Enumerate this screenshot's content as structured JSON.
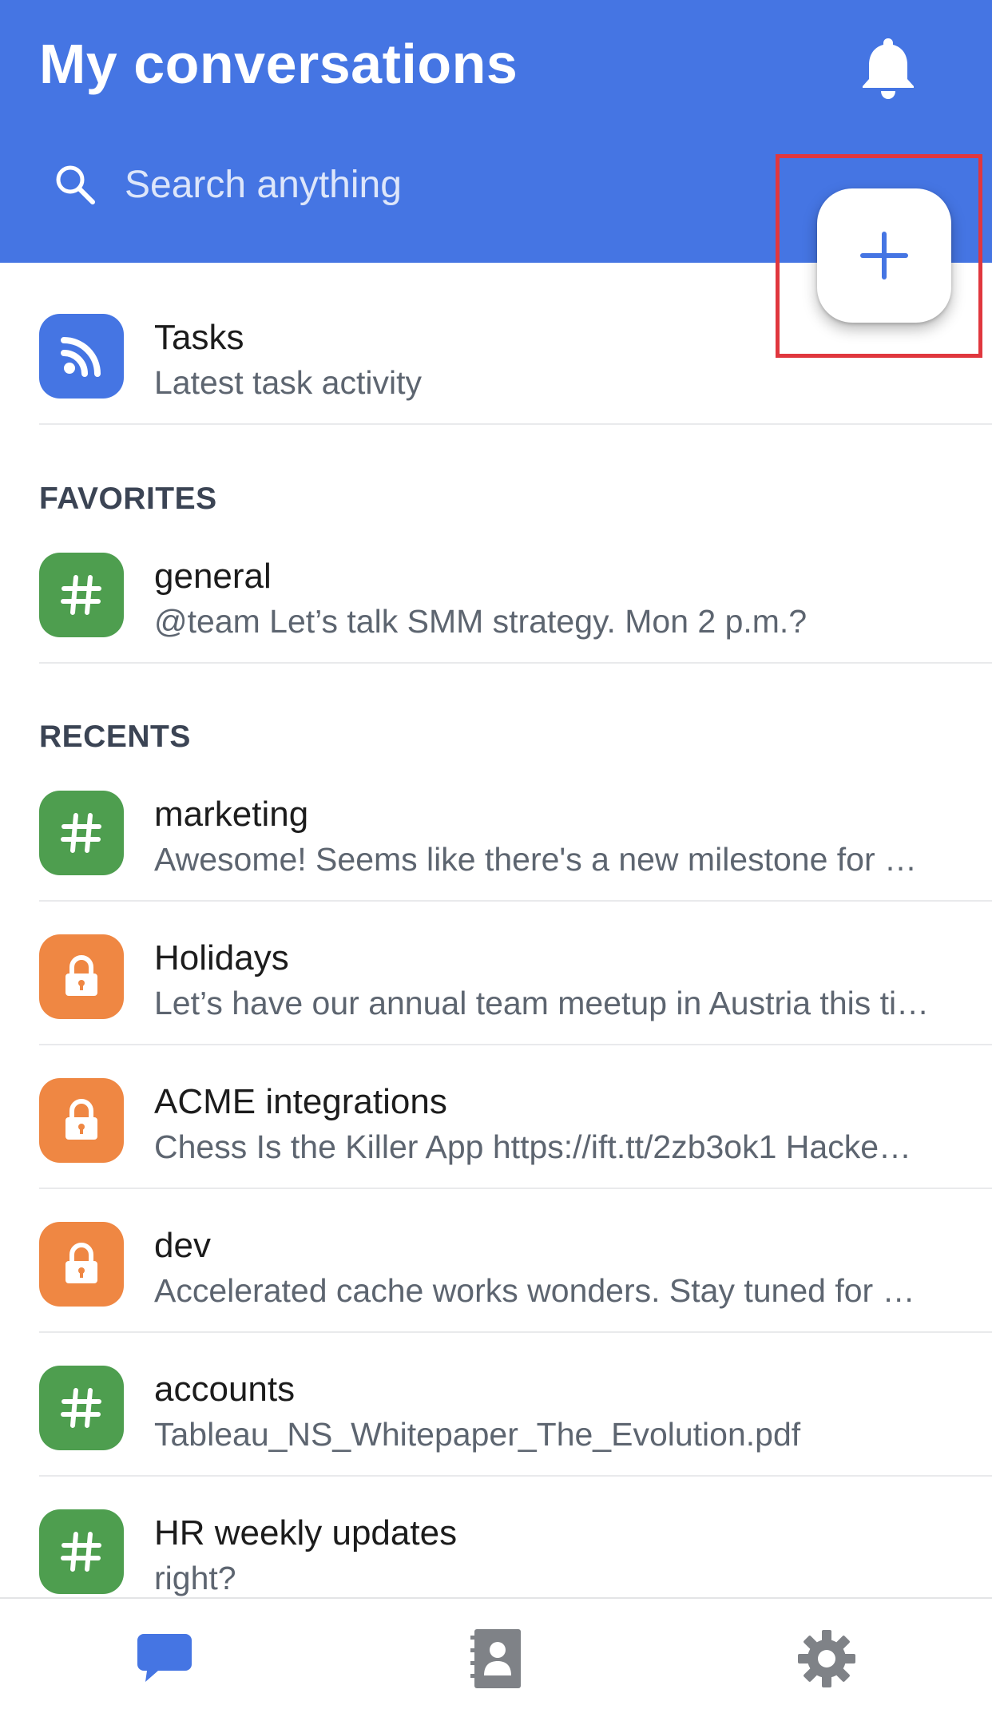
{
  "header": {
    "title": "My conversations",
    "search_placeholder": "Search anything"
  },
  "tasks": {
    "name": "Tasks",
    "preview": "Latest task activity",
    "icon": "rss-icon"
  },
  "sections": {
    "favorites_label": "FAVORITES",
    "recents_label": "RECENTS"
  },
  "favorites": [
    {
      "name": "general",
      "preview": "@team Let’s talk SMM strategy. Mon 2 p.m.?",
      "type": "channel"
    }
  ],
  "recents": [
    {
      "name": "marketing",
      "preview": "Awesome! Seems like there's a new milestone for …",
      "type": "channel"
    },
    {
      "name": "Holidays",
      "preview": "Let’s have our annual team meetup in Austria this ti…",
      "type": "private"
    },
    {
      "name": "ACME integrations",
      "preview": "Chess Is the Killer App https://ift.tt/2zb3ok1 Hacke…",
      "type": "private"
    },
    {
      "name": "dev",
      "preview": "Accelerated cache works wonders. Stay tuned for …",
      "type": "private"
    },
    {
      "name": "accounts",
      "preview": "Tableau_NS_Whitepaper_The_Evolution.pdf",
      "type": "channel"
    },
    {
      "name": "HR weekly updates",
      "preview": "right?",
      "type": "channel"
    }
  ],
  "bottom_nav": [
    {
      "icon": "chat-bubble-icon",
      "active": true
    },
    {
      "icon": "contacts-book-icon",
      "active": false
    },
    {
      "icon": "gear-icon",
      "active": false
    }
  ],
  "colors": {
    "header": "#4575e3",
    "channel": "#4e9e4f",
    "private": "#ef8743",
    "highlight": "#e0373e"
  }
}
